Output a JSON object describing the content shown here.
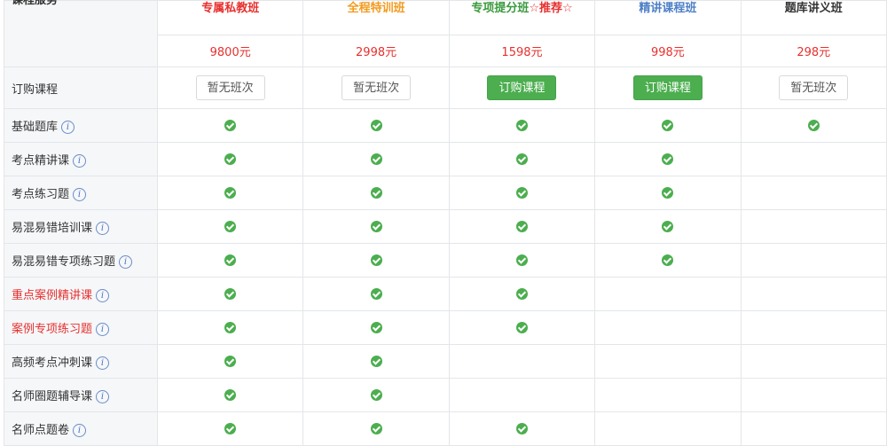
{
  "header_label": "课程服务",
  "colors": {
    "red": "#e8302e",
    "orange": "#f39a1e",
    "green": "#3a9a3d",
    "blue": "#4d7fc6",
    "dark": "#333333",
    "button_green": "#4cae4f"
  },
  "plans": [
    {
      "name": "专属私教班",
      "name_color": "#e8302e",
      "recommend": "",
      "price": "9800元",
      "button": "暂无班次",
      "button_type": "disabled"
    },
    {
      "name": "全程特训班",
      "name_color": "#f39a1e",
      "recommend": "",
      "price": "2998元",
      "button": "暂无班次",
      "button_type": "disabled"
    },
    {
      "name": "专项提分班",
      "name_color": "#3a9a3d",
      "recommend": "☆推荐☆",
      "price": "1598元",
      "button": "订购课程",
      "button_type": "buy"
    },
    {
      "name": "精讲课程班",
      "name_color": "#4d7fc6",
      "recommend": "",
      "price": "998元",
      "button": "订购课程",
      "button_type": "buy"
    },
    {
      "name": "题库讲义班",
      "name_color": "#333333",
      "recommend": "",
      "price": "298元",
      "button": "暂无班次",
      "button_type": "disabled"
    }
  ],
  "buy_row_label": "订购课程",
  "info_glyph": "i",
  "features": [
    {
      "label": "基础题库",
      "red": false,
      "included": [
        true,
        true,
        true,
        true,
        true
      ]
    },
    {
      "label": "考点精讲课",
      "red": false,
      "included": [
        true,
        true,
        true,
        true,
        false
      ]
    },
    {
      "label": "考点练习题",
      "red": false,
      "included": [
        true,
        true,
        true,
        true,
        false
      ]
    },
    {
      "label": "易混易错培训课",
      "red": false,
      "included": [
        true,
        true,
        true,
        true,
        false
      ]
    },
    {
      "label": "易混易错专项练习题",
      "red": false,
      "included": [
        true,
        true,
        true,
        true,
        false
      ]
    },
    {
      "label": "重点案例精讲课",
      "red": true,
      "included": [
        true,
        true,
        true,
        false,
        false
      ]
    },
    {
      "label": "案例专项练习题",
      "red": true,
      "included": [
        true,
        true,
        true,
        false,
        false
      ]
    },
    {
      "label": "高频考点冲刺课",
      "red": false,
      "included": [
        true,
        true,
        false,
        false,
        false
      ]
    },
    {
      "label": "名师圈题辅导课",
      "red": false,
      "included": [
        true,
        true,
        false,
        false,
        false
      ]
    },
    {
      "label": "名师点题卷",
      "red": false,
      "included": [
        true,
        true,
        true,
        false,
        false
      ]
    }
  ]
}
